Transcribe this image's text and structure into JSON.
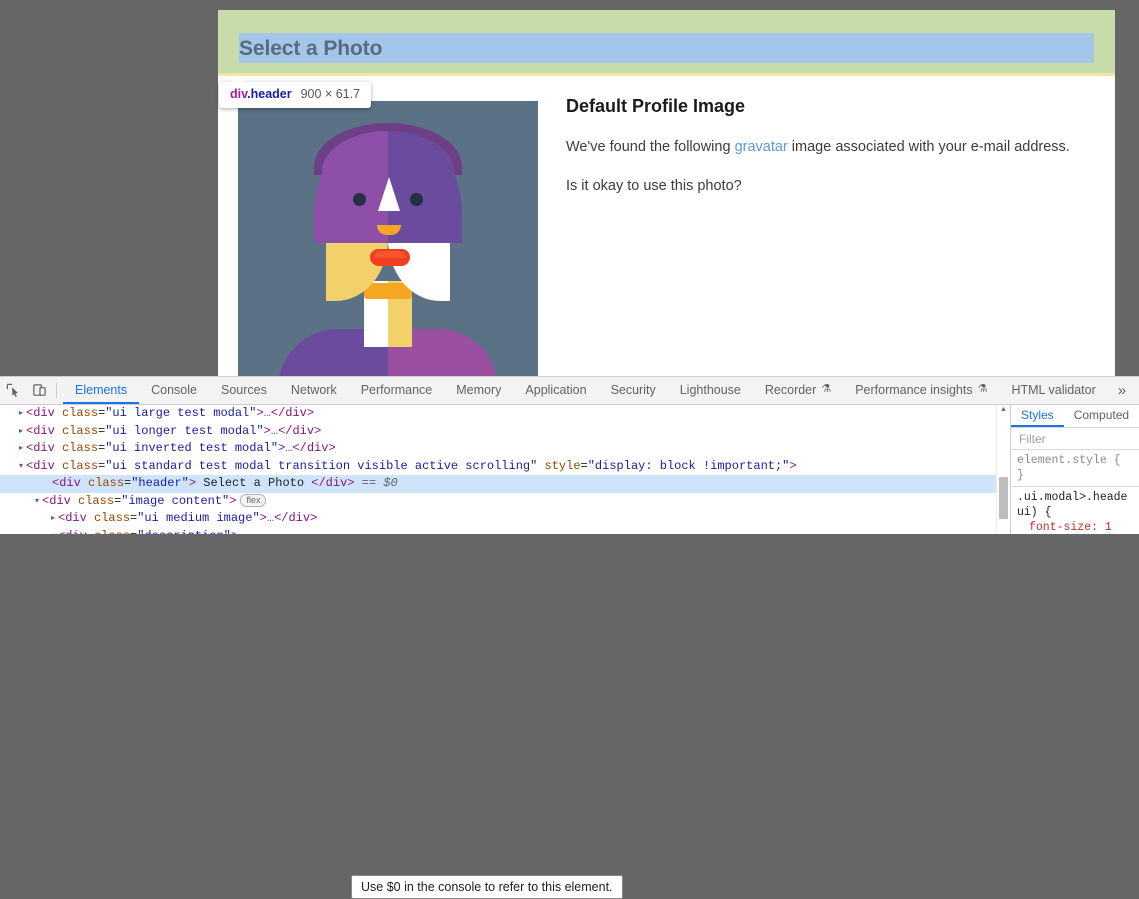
{
  "modal": {
    "header_title": "Select a Photo",
    "detail_heading": "Default Profile Image",
    "paragraph1_before": "We've found the following ",
    "paragraph1_link": "gravatar",
    "paragraph1_after": " image associated with your e-mail address.",
    "paragraph2": "Is it okay to use this photo?"
  },
  "inspect_badge": {
    "tag": "div",
    "class": ".header",
    "dimensions": "900 × 61.7"
  },
  "devtools": {
    "toolbar_icons": [
      {
        "name": "inspect-element-icon"
      },
      {
        "name": "device-toolbar-icon"
      }
    ],
    "tabs": [
      {
        "label": "Elements",
        "active": true,
        "experiment": false
      },
      {
        "label": "Console",
        "active": false,
        "experiment": false
      },
      {
        "label": "Sources",
        "active": false,
        "experiment": false
      },
      {
        "label": "Network",
        "active": false,
        "experiment": false
      },
      {
        "label": "Performance",
        "active": false,
        "experiment": false
      },
      {
        "label": "Memory",
        "active": false,
        "experiment": false
      },
      {
        "label": "Application",
        "active": false,
        "experiment": false
      },
      {
        "label": "Security",
        "active": false,
        "experiment": false
      },
      {
        "label": "Lighthouse",
        "active": false,
        "experiment": false
      },
      {
        "label": "Recorder",
        "active": false,
        "experiment": true
      },
      {
        "label": "Performance insights",
        "active": false,
        "experiment": true
      },
      {
        "label": "HTML validator",
        "active": false,
        "experiment": false
      }
    ],
    "more_tabs_label": "»",
    "flask_glyph": "⚗",
    "dom_rows": [
      {
        "twisty": "▸",
        "indent": 26,
        "selected": false,
        "parts": [
          {
            "t": "pnk",
            "s": "<div "
          },
          {
            "t": "org",
            "s": "class"
          },
          {
            "t": "txt",
            "s": "="
          },
          {
            "t": "blu",
            "s": "\"ui large test modal\""
          },
          {
            "t": "pnk",
            "s": ">"
          },
          {
            "t": "gry",
            "s": "…"
          },
          {
            "t": "pnk",
            "s": "</div>"
          }
        ]
      },
      {
        "twisty": "▸",
        "indent": 26,
        "selected": false,
        "parts": [
          {
            "t": "pnk",
            "s": "<div "
          },
          {
            "t": "org",
            "s": "class"
          },
          {
            "t": "txt",
            "s": "="
          },
          {
            "t": "blu",
            "s": "\"ui longer test modal\""
          },
          {
            "t": "pnk",
            "s": ">"
          },
          {
            "t": "gry",
            "s": "…"
          },
          {
            "t": "pnk",
            "s": "</div>"
          }
        ]
      },
      {
        "twisty": "▸",
        "indent": 26,
        "selected": false,
        "parts": [
          {
            "t": "pnk",
            "s": "<div "
          },
          {
            "t": "org",
            "s": "class"
          },
          {
            "t": "txt",
            "s": "="
          },
          {
            "t": "blu",
            "s": "\"ui inverted test modal\""
          },
          {
            "t": "pnk",
            "s": ">"
          },
          {
            "t": "gry",
            "s": "…"
          },
          {
            "t": "pnk",
            "s": "</div>"
          }
        ]
      },
      {
        "twisty": "▾",
        "indent": 26,
        "selected": false,
        "parts": [
          {
            "t": "pnk",
            "s": "<div "
          },
          {
            "t": "org",
            "s": "class"
          },
          {
            "t": "txt",
            "s": "="
          },
          {
            "t": "blu",
            "s": "\"ui standard test modal transition visible active scrolling\""
          },
          {
            "t": "txt",
            "s": " "
          },
          {
            "t": "org",
            "s": "style"
          },
          {
            "t": "txt",
            "s": "="
          },
          {
            "t": "blu",
            "s": "\"display: block !important;\""
          },
          {
            "t": "pnk",
            "s": ">"
          }
        ]
      },
      {
        "twisty": "",
        "indent": 52,
        "selected": true,
        "parts": [
          {
            "t": "pnk",
            "s": "<div "
          },
          {
            "t": "org",
            "s": "class"
          },
          {
            "t": "txt",
            "s": "="
          },
          {
            "t": "blu",
            "s": "\"header\""
          },
          {
            "t": "pnk",
            "s": ">"
          },
          {
            "t": "txt",
            "s": " Select a Photo "
          },
          {
            "t": "pnk",
            "s": "</div>"
          },
          {
            "t": "ital",
            "s": " == $0"
          }
        ]
      },
      {
        "twisty": "▾",
        "indent": 42,
        "selected": false,
        "badge": "flex",
        "parts": [
          {
            "t": "pnk",
            "s": "<div "
          },
          {
            "t": "org",
            "s": "class"
          },
          {
            "t": "txt",
            "s": "="
          },
          {
            "t": "blu",
            "s": "\"image content\""
          },
          {
            "t": "pnk",
            "s": ">"
          }
        ]
      },
      {
        "twisty": "▸",
        "indent": 58,
        "selected": false,
        "parts": [
          {
            "t": "pnk",
            "s": "<div "
          },
          {
            "t": "org",
            "s": "class"
          },
          {
            "t": "txt",
            "s": "="
          },
          {
            "t": "blu",
            "s": "\"ui medium image\""
          },
          {
            "t": "pnk",
            "s": ">"
          },
          {
            "t": "gry",
            "s": "…"
          },
          {
            "t": "pnk",
            "s": "</div>"
          }
        ]
      },
      {
        "twisty": "▾",
        "indent": 58,
        "selected": false,
        "parts": [
          {
            "t": "pnk",
            "s": "<div "
          },
          {
            "t": "org",
            "s": "class"
          },
          {
            "t": "txt",
            "s": "="
          },
          {
            "t": "blu",
            "s": "\"description\""
          },
          {
            "t": "pnk",
            "s": ">"
          }
        ]
      }
    ],
    "dollar_tooltip": "Use $0 in the console to refer to this element.",
    "styles": {
      "tabs": [
        {
          "label": "Styles",
          "active": true
        },
        {
          "label": "Computed",
          "active": false
        }
      ],
      "filter_placeholder": "Filter",
      "rule1_selector": "element.style {",
      "rule1_close": "}",
      "rule2_line1": ".ui.modal>.heade",
      "rule2_line2": "ui) {",
      "rule2_line3": "font-size: 1"
    }
  },
  "colors": {
    "accent": "#1a73e8",
    "header_padding_highlight": "#c7dbab",
    "header_content_highlight": "#a4c6e9",
    "header_margin_highlight": "#f3e5a9",
    "dimmer": "#666666",
    "selected_row": "#cfe4fb",
    "link": "#5b9bd5",
    "avatar_background": "#5a7186"
  }
}
